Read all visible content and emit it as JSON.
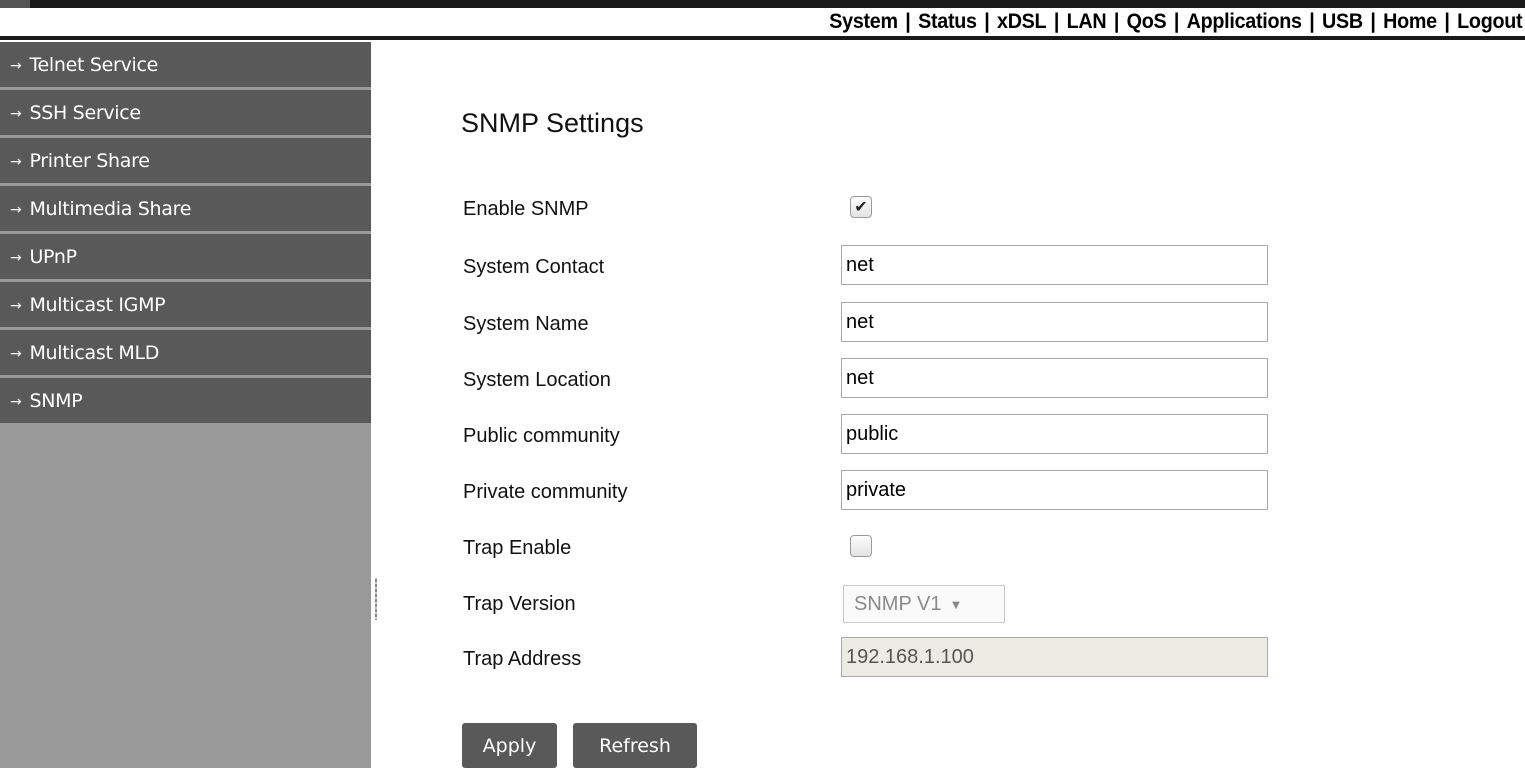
{
  "topnav": {
    "items": [
      "System",
      "Status",
      "xDSL",
      "LAN",
      "QoS",
      "Applications",
      "USB",
      "Home",
      "Logout"
    ],
    "separator": "|"
  },
  "sidebar": {
    "arrow": "→",
    "items": [
      {
        "label": "Telnet Service"
      },
      {
        "label": "SSH Service"
      },
      {
        "label": "Printer Share"
      },
      {
        "label": "Multimedia Share"
      },
      {
        "label": "UPnP"
      },
      {
        "label": "Multicast IGMP"
      },
      {
        "label": "Multicast MLD"
      },
      {
        "label": "SNMP"
      }
    ]
  },
  "main": {
    "title": "SNMP Settings",
    "enable_snmp": {
      "label": "Enable SNMP",
      "checked": true,
      "mark": "✔"
    },
    "system_contact": {
      "label": "System Contact",
      "value": "net"
    },
    "system_name": {
      "label": "System Name",
      "value": "net"
    },
    "system_location": {
      "label": "System Location",
      "value": "net"
    },
    "public_community": {
      "label": "Public community",
      "value": "public"
    },
    "private_community": {
      "label": "Private community",
      "value": "private"
    },
    "trap_enable": {
      "label": "Trap Enable",
      "checked": false,
      "mark": ""
    },
    "trap_version": {
      "label": "Trap Version",
      "value": "SNMP V1",
      "caret": "▼"
    },
    "trap_address": {
      "label": "Trap Address",
      "value": "192.168.1.100"
    },
    "apply_label": "Apply",
    "refresh_label": "Refresh"
  },
  "colors": {
    "sidebar_item_bg": "#595959",
    "sidebar_bg": "#999999",
    "topbar_dark": "#1a1a1a",
    "disabled_field_bg": "#ebebe4"
  }
}
